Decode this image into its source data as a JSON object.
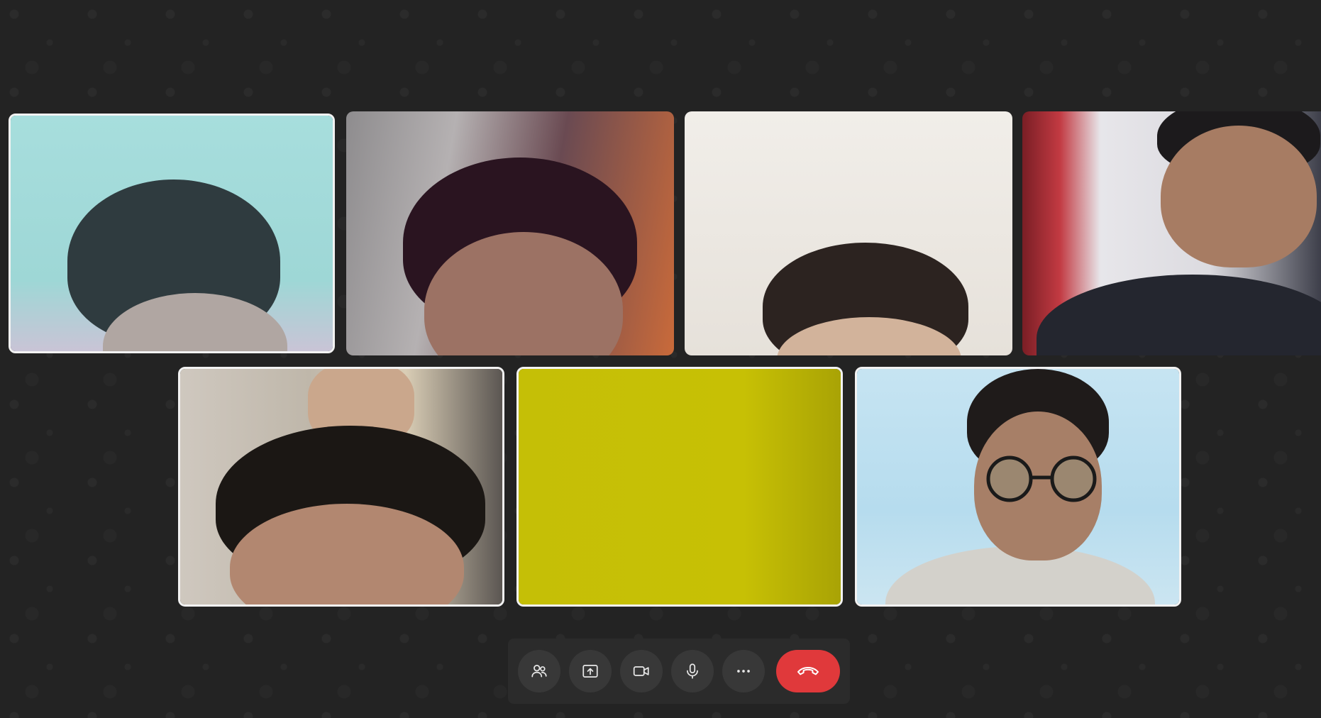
{
  "call": {
    "participants": [
      {
        "id": "p1",
        "speaking": true
      },
      {
        "id": "p2",
        "speaking": false
      },
      {
        "id": "p3",
        "speaking": false
      },
      {
        "id": "p4",
        "speaking": false
      },
      {
        "id": "p5",
        "speaking": true
      },
      {
        "id": "p6",
        "speaking": true
      },
      {
        "id": "p7",
        "speaking": true
      }
    ]
  },
  "controls": {
    "participants_icon": "participants-icon",
    "share_screen_icon": "share-screen-icon",
    "camera_icon": "video-camera-icon",
    "mic_icon": "microphone-icon",
    "more_icon": "more-options-icon",
    "end_call_icon": "end-call-icon",
    "end_call_color": "#e0393b",
    "button_bg": "#383838"
  },
  "colors": {
    "background": "#232323",
    "active_border": "#f2f2f2"
  }
}
